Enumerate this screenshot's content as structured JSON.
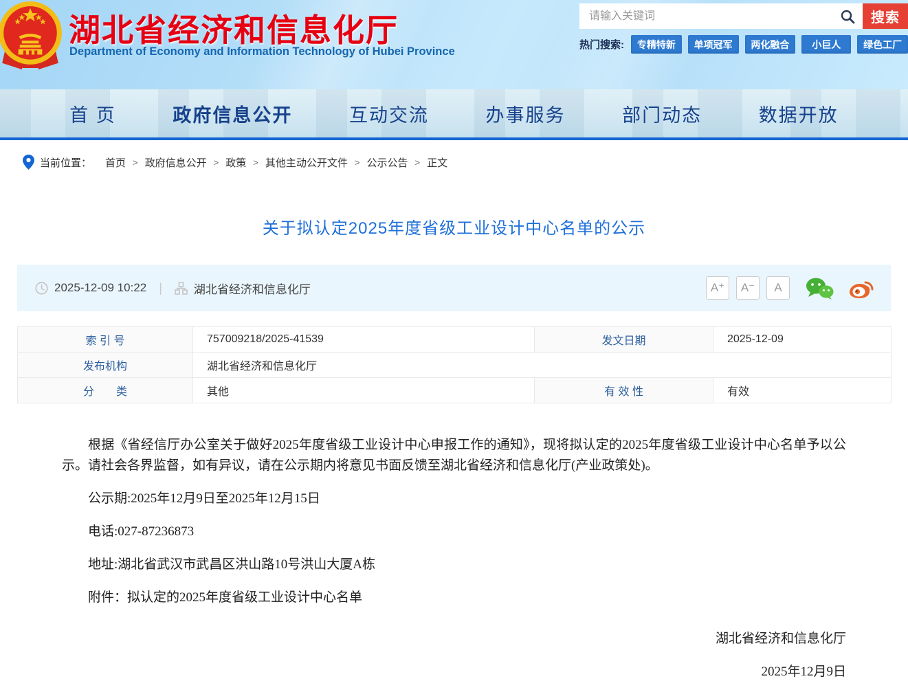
{
  "header": {
    "site_title": "湖北省经济和信息化厅",
    "site_subtitle": "Department of Economy and Information Technology of Hubei Province",
    "search": {
      "placeholder": "请输入关键词",
      "button_label": "搜索"
    },
    "hot_search_label": "热门搜索:",
    "hot_search_tags": [
      "专精特新",
      "单项冠军",
      "两化融合",
      "小巨人",
      "绿色工厂"
    ]
  },
  "nav": {
    "items": [
      {
        "label": "首 页",
        "active": false
      },
      {
        "label": "政府信息公开",
        "active": true
      },
      {
        "label": "互动交流",
        "active": false
      },
      {
        "label": "办事服务",
        "active": false
      },
      {
        "label": "部门动态",
        "active": false
      },
      {
        "label": "数据开放",
        "active": false
      }
    ]
  },
  "breadcrumb": {
    "location_label": "当前位置：",
    "separator": ">",
    "items": [
      "首页",
      "政府信息公开",
      "政策",
      "其他主动公开文件",
      "公示公告",
      "正文"
    ]
  },
  "article": {
    "title": "关于拟认定2025年度省级工业设计中心名单的公示",
    "meta": {
      "datetime": "2025-12-09 10:22",
      "source": "湖北省经济和信息化厅",
      "divider": "|",
      "font_larger": "A⁺",
      "font_smaller": "A⁻",
      "font_reset": "A"
    }
  },
  "info_table": {
    "label_index": "索 引 号",
    "value_index": "757009218/2025-41539",
    "label_date": "发文日期",
    "value_date": "2025-12-09",
    "label_org": "发布机构",
    "value_org": "湖北省经济和信息化厅",
    "label_category": "分　　类",
    "value_category": "其他",
    "label_validity": "有 效 性",
    "value_validity": "有效"
  },
  "body": {
    "paragraph1": "根据《省经信厅办公室关于做好2025年度省级工业设计中心申报工作的通知》，现将拟认定的2025年度省级工业设计中心名单予以公示。请社会各界监督，如有异议，请在公示期内将意见书面反馈至湖北省经济和信息化厅(产业政策处)。",
    "publicity_period": "公示期:2025年12月9日至2025年12月15日",
    "phone": "电话:027-87236873",
    "address": "地址:湖北省武汉市武昌区洪山路10号洪山大厦A栋",
    "attachment_label": "附件：",
    "attachment_name": "拟认定的2025年度省级工业设计中心名单",
    "signature_org": "湖北省经济和信息化厅",
    "signature_date": "2025年12月9日"
  },
  "icons": {
    "emblem_icon": "china-national-emblem",
    "search_icon": "magnifier",
    "location_icon": "map-pin",
    "clock_icon": "clock",
    "source_icon": "org-chart",
    "wechat_icon": "wechat-share",
    "weibo_icon": "weibo-share"
  },
  "colors": {
    "title_red": "#e60012",
    "search_button_red": "#e64034",
    "tag_blue": "#2e7ad1",
    "nav_blue": "#16418c",
    "nav_border_blue": "#1467d2",
    "link_blue": "#1e6fd9",
    "table_label_blue": "#2d5f9e",
    "meta_bar_bg": "#eaf6fd",
    "wechat_green": "#45b035",
    "weibo_orange": "#e6662b"
  }
}
